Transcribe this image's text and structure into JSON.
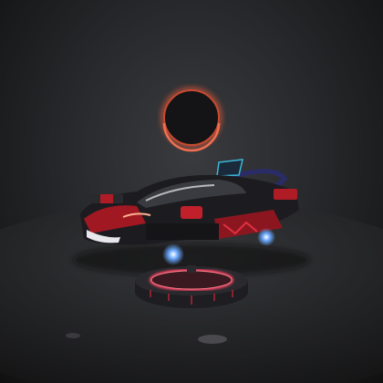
{
  "colors": {
    "background": "#2a2b2e",
    "ring_glow": "#e0583a",
    "car_red": "#c0202a",
    "car_body": "#1c1c20",
    "thruster_blue": "#6aa8ff",
    "pad_glow": "#ff4060"
  }
}
